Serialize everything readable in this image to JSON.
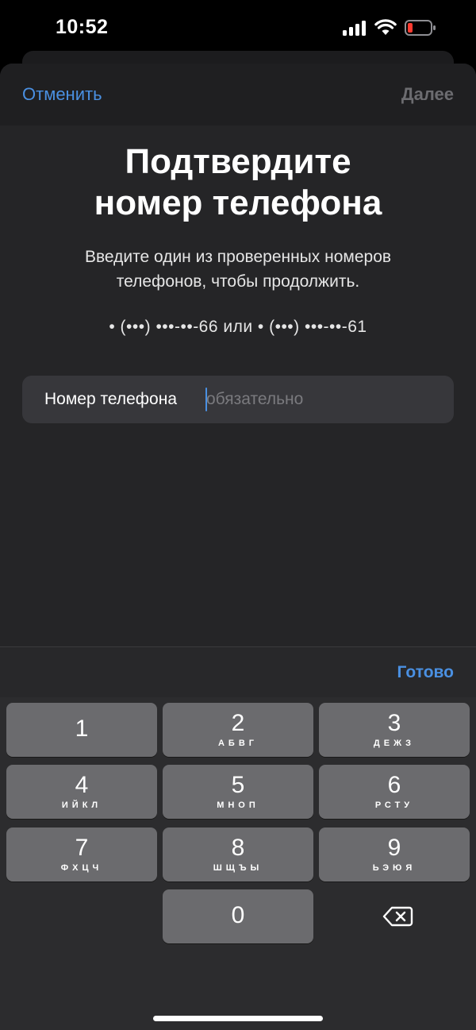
{
  "status_bar": {
    "time": "10:52",
    "icons": [
      "cellular-signal-icon",
      "wifi-icon",
      "battery-low-icon"
    ],
    "battery_color": "#ff3b30"
  },
  "nav": {
    "cancel_label": "Отменить",
    "next_label": "Далее"
  },
  "main": {
    "title_line1": "Подтвердите",
    "title_line2": "номер телефона",
    "subtitle_line1": "Введите один из проверенных номеров",
    "subtitle_line2": "телефонов, чтобы продолжить.",
    "numbers": "• (•••) •••-••-66 или • (•••) •••-••-61"
  },
  "phone_field": {
    "label": "Номер телефона",
    "value": "",
    "placeholder": "обязательно"
  },
  "toolbar": {
    "done_label": "Готово"
  },
  "keyboard": {
    "keys": [
      {
        "digit": "1",
        "letters": ""
      },
      {
        "digit": "2",
        "letters": "АБВГ"
      },
      {
        "digit": "3",
        "letters": "ДЕЖЗ"
      },
      {
        "digit": "4",
        "letters": "ИЙКЛ"
      },
      {
        "digit": "5",
        "letters": "МНОП"
      },
      {
        "digit": "6",
        "letters": "РСТУ"
      },
      {
        "digit": "7",
        "letters": "ФХЦЧ"
      },
      {
        "digit": "8",
        "letters": "ШЩЪЫ"
      },
      {
        "digit": "9",
        "letters": "ЬЭЮЯ"
      },
      {
        "digit": "0",
        "letters": ""
      }
    ],
    "delete_icon": "backspace-icon"
  },
  "colors": {
    "accent": "#4a90e2",
    "background": "#252527",
    "key": "#6b6b6e"
  }
}
